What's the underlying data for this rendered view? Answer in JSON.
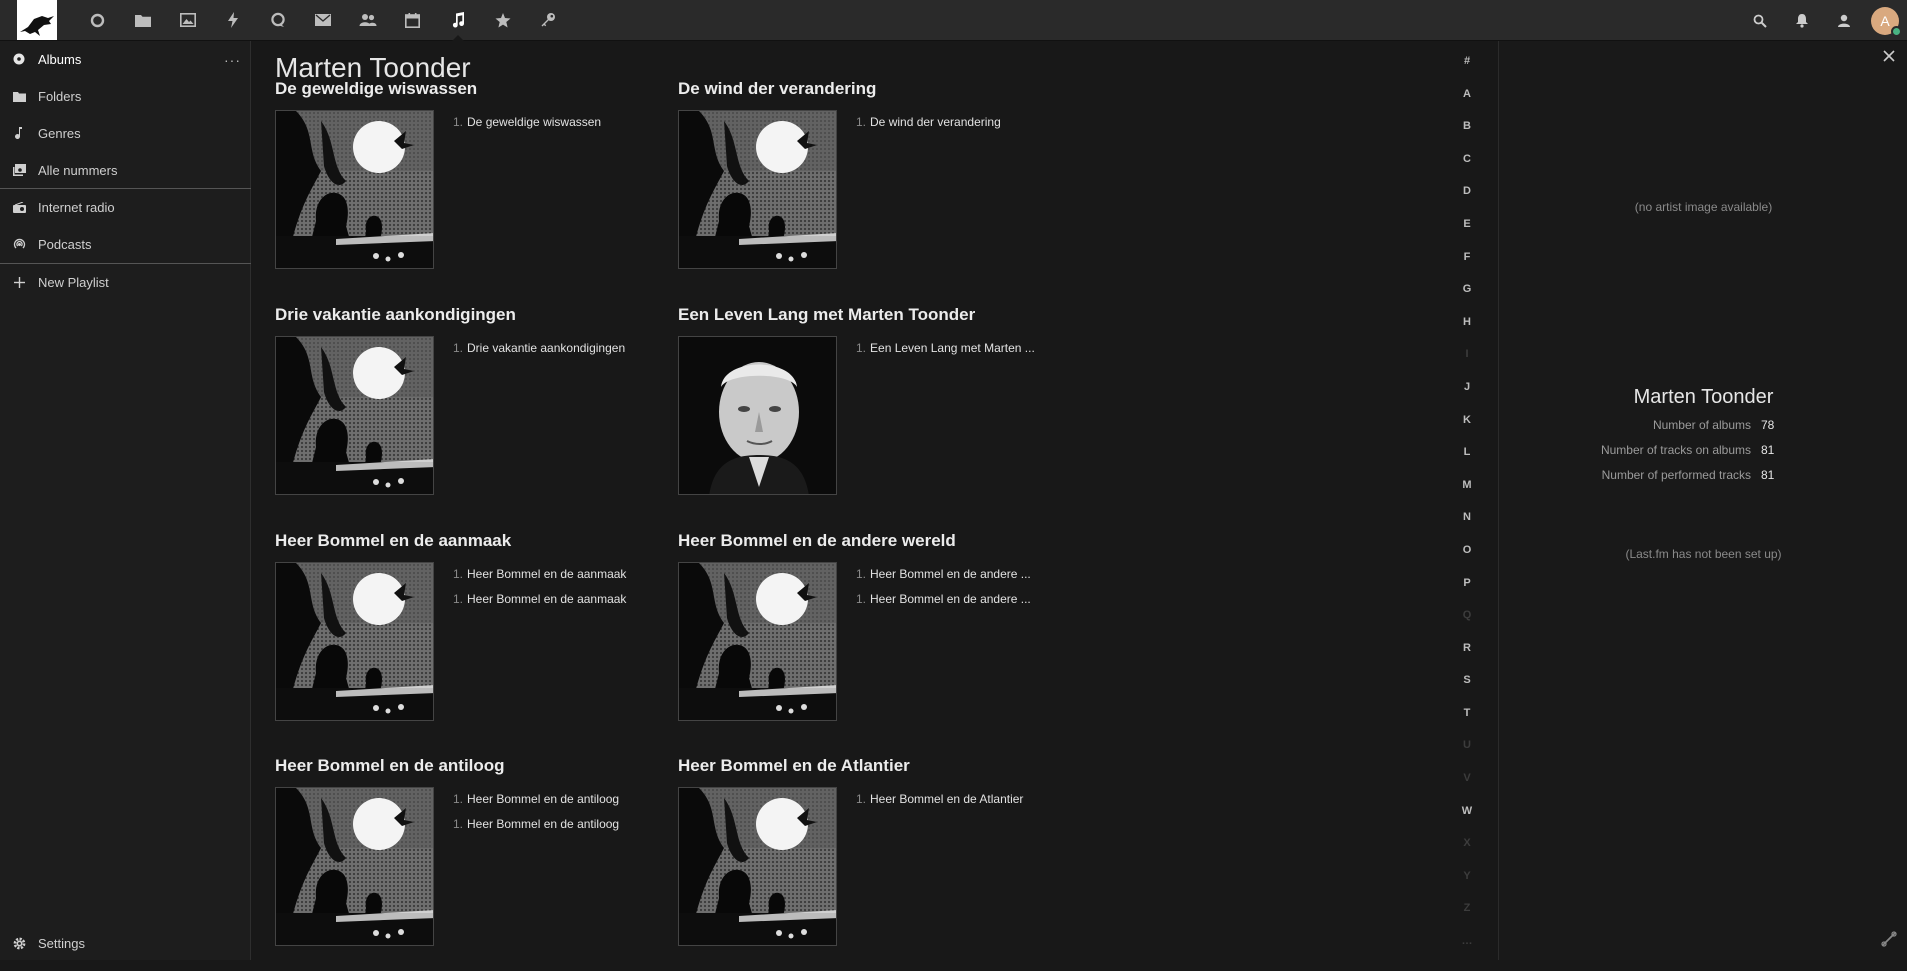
{
  "topbar": {
    "apps": [
      {
        "name": "dashboard-icon"
      },
      {
        "name": "files-icon"
      },
      {
        "name": "photos-icon"
      },
      {
        "name": "activity-icon"
      },
      {
        "name": "talk-icon"
      },
      {
        "name": "mail-icon"
      },
      {
        "name": "contacts-icon"
      },
      {
        "name": "calendar-icon"
      },
      {
        "name": "music-icon",
        "active": true
      },
      {
        "name": "star-icon"
      },
      {
        "name": "passwords-icon"
      }
    ],
    "avatar_letter": "A"
  },
  "sidebar": {
    "items": [
      {
        "label": "Albums",
        "icon": "album-icon",
        "active": true
      },
      {
        "label": "Folders",
        "icon": "folder-icon"
      },
      {
        "label": "Genres",
        "icon": "genre-icon"
      },
      {
        "label": "Alle nummers",
        "icon": "tracks-icon"
      },
      {
        "label": "Internet radio",
        "icon": "radio-icon"
      },
      {
        "label": "Podcasts",
        "icon": "podcast-icon"
      },
      {
        "label": "New Playlist",
        "icon": "plus-icon"
      }
    ],
    "more": "···",
    "settings_label": "Settings"
  },
  "main": {
    "artist": "Marten Toonder",
    "albums": [
      {
        "title": "De geweldige wiswassen",
        "cover": "silhouette",
        "tracks": [
          {
            "num": "1.",
            "title": "De geweldige wiswassen"
          }
        ]
      },
      {
        "title": "De wind der verandering",
        "cover": "silhouette",
        "tracks": [
          {
            "num": "1.",
            "title": "De wind der verandering"
          }
        ]
      },
      {
        "title": "Drie vakantie aankondigingen",
        "cover": "silhouette",
        "tracks": [
          {
            "num": "1.",
            "title": "Drie vakantie aankondigingen"
          }
        ]
      },
      {
        "title": "Een Leven Lang met Marten Toonder",
        "cover": "portrait",
        "tracks": [
          {
            "num": "1.",
            "title": "Een Leven Lang met Marten ..."
          }
        ]
      },
      {
        "title": "Heer Bommel en de aanmaak",
        "cover": "silhouette",
        "tracks": [
          {
            "num": "1.",
            "title": "Heer Bommel en de aanmaak"
          },
          {
            "num": "1.",
            "title": "Heer Bommel en de aanmaak"
          }
        ]
      },
      {
        "title": "Heer Bommel en de andere wereld",
        "cover": "silhouette",
        "tracks": [
          {
            "num": "1.",
            "title": "Heer Bommel en de andere ..."
          },
          {
            "num": "1.",
            "title": "Heer Bommel en de andere ..."
          }
        ]
      },
      {
        "title": "Heer Bommel en de antiloog",
        "cover": "silhouette",
        "tracks": [
          {
            "num": "1.",
            "title": "Heer Bommel en de antiloog"
          },
          {
            "num": "1.",
            "title": "Heer Bommel en de antiloog"
          }
        ]
      },
      {
        "title": "Heer Bommel en de Atlantier",
        "cover": "silhouette",
        "tracks": [
          {
            "num": "1.",
            "title": "Heer Bommel en de Atlantier"
          }
        ]
      }
    ]
  },
  "alphabet": [
    {
      "l": "#",
      "on": true
    },
    {
      "l": "A",
      "on": true
    },
    {
      "l": "B",
      "on": true
    },
    {
      "l": "C",
      "on": true
    },
    {
      "l": "D",
      "on": true
    },
    {
      "l": "E",
      "on": true
    },
    {
      "l": "F",
      "on": true
    },
    {
      "l": "G",
      "on": true
    },
    {
      "l": "H",
      "on": true
    },
    {
      "l": "I",
      "on": false
    },
    {
      "l": "J",
      "on": true
    },
    {
      "l": "K",
      "on": true
    },
    {
      "l": "L",
      "on": true
    },
    {
      "l": "M",
      "on": true
    },
    {
      "l": "N",
      "on": true
    },
    {
      "l": "O",
      "on": true
    },
    {
      "l": "P",
      "on": true
    },
    {
      "l": "Q",
      "on": false
    },
    {
      "l": "R",
      "on": true
    },
    {
      "l": "S",
      "on": true
    },
    {
      "l": "T",
      "on": true
    },
    {
      "l": "U",
      "on": false
    },
    {
      "l": "V",
      "on": false
    },
    {
      "l": "W",
      "on": true
    },
    {
      "l": "X",
      "on": false
    },
    {
      "l": "Y",
      "on": false
    },
    {
      "l": "Z",
      "on": false
    },
    {
      "l": "…",
      "on": false
    }
  ],
  "details": {
    "no_image": "(no artist image available)",
    "artist_name": "Marten Toonder",
    "stats": [
      {
        "label": "Number of albums",
        "value": "78"
      },
      {
        "label": "Number of tracks on albums",
        "value": "81"
      },
      {
        "label": "Number of performed tracks",
        "value": "81"
      }
    ],
    "lastfm": "(Last.fm has not been set up)"
  }
}
